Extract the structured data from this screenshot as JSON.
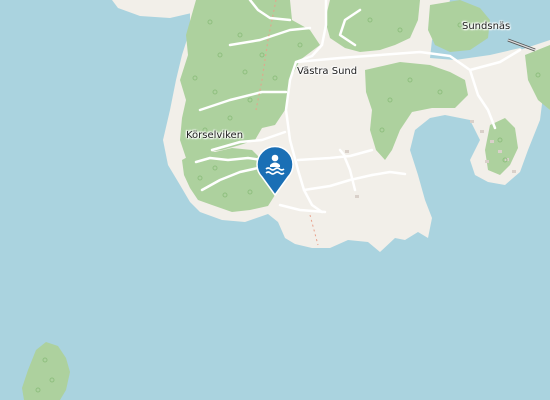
{
  "map": {
    "colors": {
      "water": "#aad3df",
      "land": "#f2efe9",
      "forest": "#add19e",
      "road": "#ffffff",
      "marker": "#1a6fb5"
    },
    "labels": {
      "vastra_sund": "Västra Sund",
      "korselviken": "Körselviken",
      "sundsnas": "Sundsnäs"
    },
    "marker": {
      "icon": "swimmer-icon",
      "category": "bathing place"
    }
  }
}
